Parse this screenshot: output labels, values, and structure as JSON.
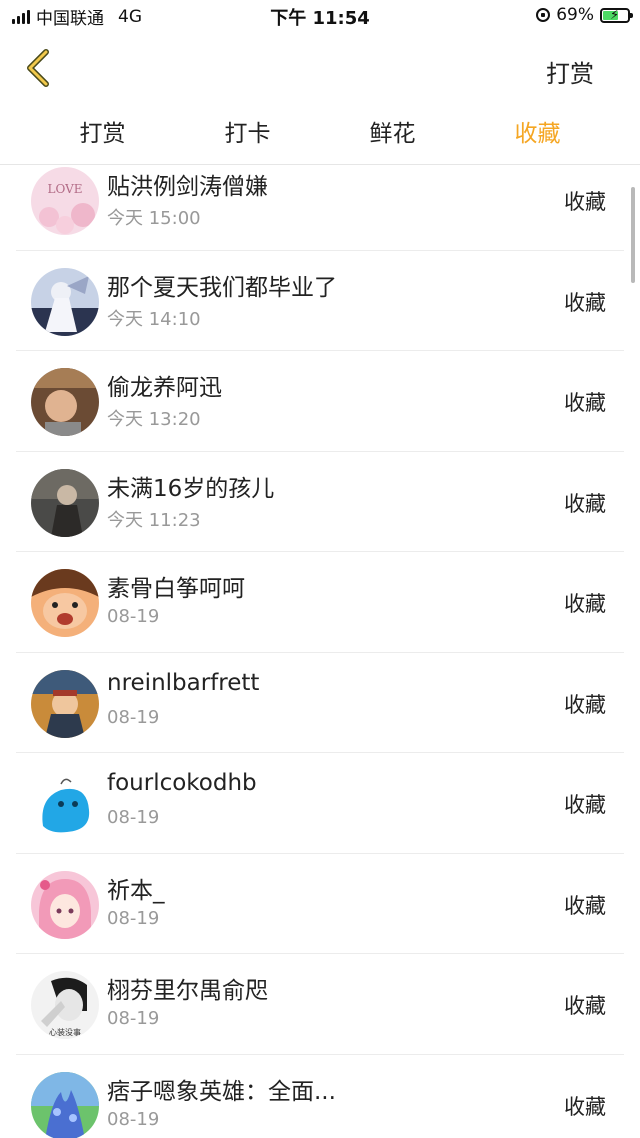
{
  "status_bar": {
    "carrier": "中国联通",
    "network": "4G",
    "time": "下午 11:54",
    "battery_pct": "69%",
    "battery_level": 0.69
  },
  "nav": {
    "right_action": "打赏",
    "back_icon": "chevron-left-icon",
    "accent_color": "#f5a623"
  },
  "tabs": [
    {
      "label": "打赏",
      "active": false
    },
    {
      "label": "打卡",
      "active": false
    },
    {
      "label": "鲜花",
      "active": false
    },
    {
      "label": "收藏",
      "active": true
    }
  ],
  "list": [
    {
      "name": "贴洪例剑涛僧嫌",
      "time": "今天 15:00",
      "action": "收藏",
      "avatar_text": "LOVE"
    },
    {
      "name": "那个夏天我们都毕业了",
      "time": "今天 14:10",
      "action": "收藏"
    },
    {
      "name": "偷龙养阿迅",
      "time": "今天 13:20",
      "action": "收藏"
    },
    {
      "name": "未满16岁的孩儿",
      "time": "今天 11:23",
      "action": "收藏"
    },
    {
      "name": "素骨白筝呵呵",
      "time": "08-19",
      "action": "收藏"
    },
    {
      "name": "nreinlbarfrett",
      "time": "08-19",
      "action": "收藏"
    },
    {
      "name": "fourlcokodhb",
      "time": "08-19",
      "action": "收藏"
    },
    {
      "name": "祈本_",
      "time": "08-19",
      "action": "收藏"
    },
    {
      "name": "栩芬里尔禺俞咫",
      "time": "08-19",
      "action": "收藏",
      "avatar_text": "心装没事"
    },
    {
      "name": "痞子嗯象英雄：全面...",
      "time": "08-19",
      "action": "收藏"
    }
  ]
}
